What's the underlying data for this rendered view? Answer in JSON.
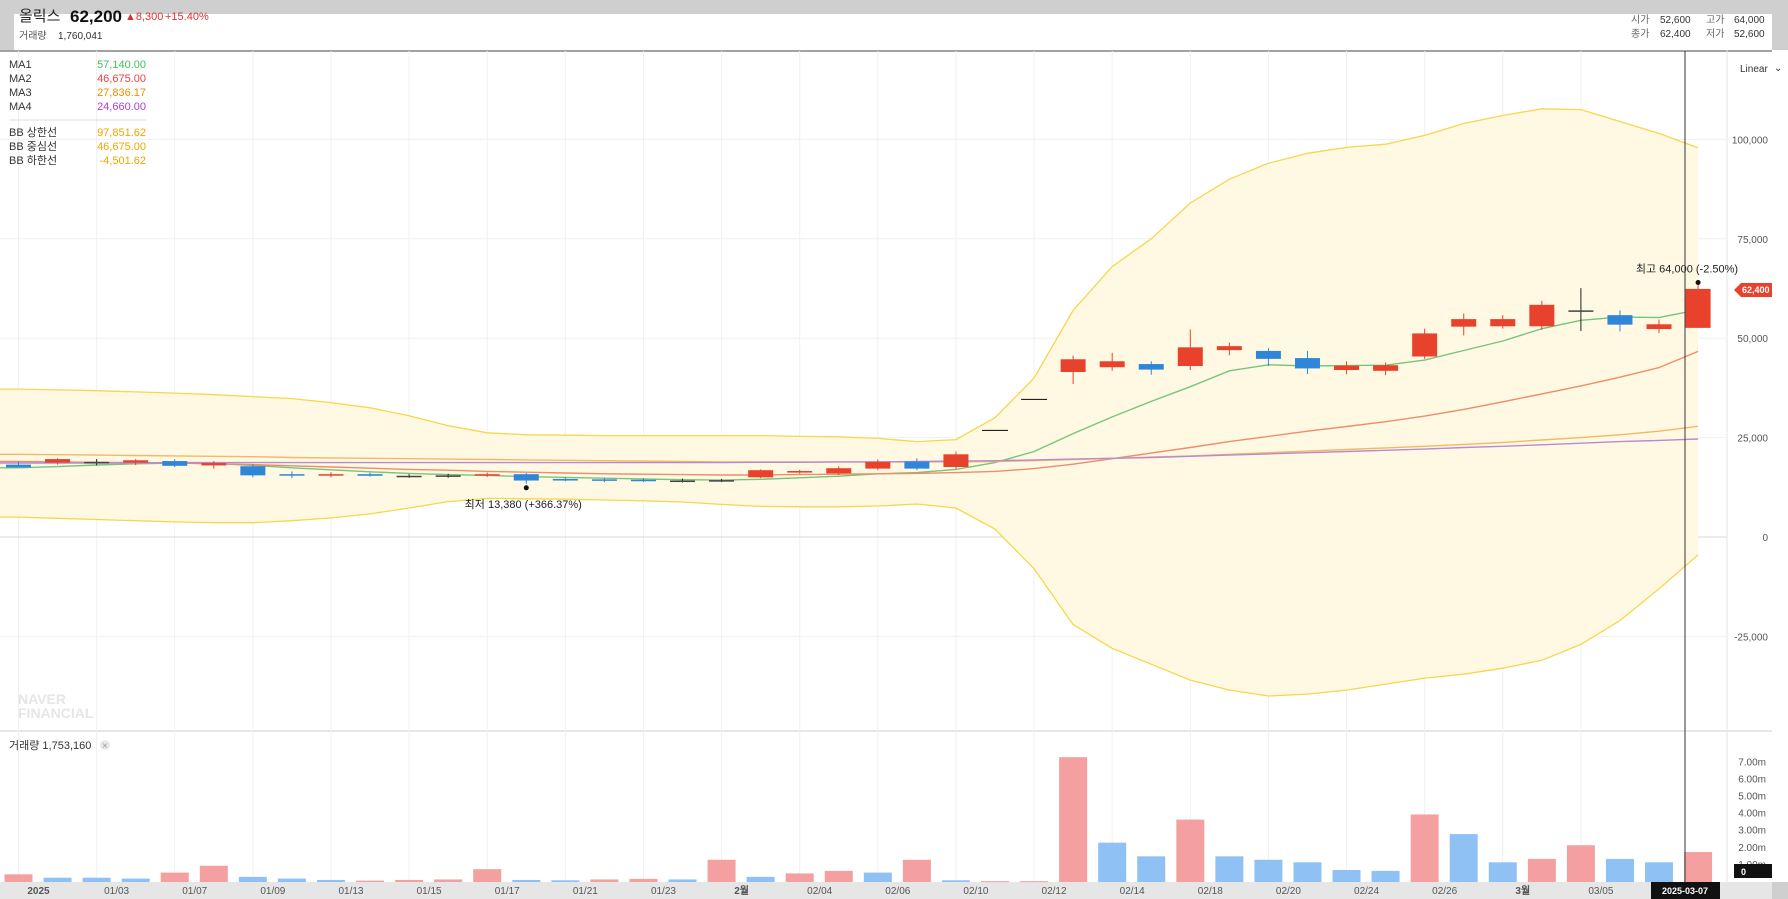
{
  "header": {
    "stock_name": "올릭스",
    "price": "62,200",
    "change": "▲8,300",
    "change_pct": "+15.40%",
    "volume_label": "거래량",
    "volume_value": "1,760,041",
    "ohlc": [
      {
        "label": "시가",
        "value": "52,600",
        "color": "#1c7ed6"
      },
      {
        "label": "고가",
        "value": "64,000",
        "color": "#e03131"
      },
      {
        "label": "종가",
        "value": "62,400",
        "color": "#e03131"
      },
      {
        "label": "저가",
        "value": "52,600",
        "color": "#1c7ed6"
      }
    ]
  },
  "legend": {
    "ma": [
      {
        "name": "MA1",
        "value": "57,140.00",
        "color": "#40c057"
      },
      {
        "name": "MA2",
        "value": "46,675.00",
        "color": "#f03e3e"
      },
      {
        "name": "MA3",
        "value": "27,836.17",
        "color": "#f08c00"
      },
      {
        "name": "MA4",
        "value": "24,660.00",
        "color": "#ae3ec9"
      }
    ],
    "bb": [
      {
        "name": "BB 상한선",
        "value": "97,851.62",
        "color": "#fab005"
      },
      {
        "name": "BB 중심선",
        "value": "46,675.00",
        "color": "#fab005"
      },
      {
        "name": "BB 하한선",
        "value": "-4,501.62",
        "color": "#fab005"
      }
    ]
  },
  "scale_mode": "Linear",
  "watermark": [
    "NAVER",
    "FINANCIAL"
  ],
  "price_badge": "62,400",
  "volume_panel": {
    "title": "거래량 1,753,160",
    "badge": "0"
  },
  "cursor_date": "2025-03-07",
  "annotations": {
    "low": "최저 13,380 (+366.37%)",
    "high": "최고 64,000 (-2.50%)"
  },
  "colors": {
    "up": "#e8412c",
    "down": "#2f86d8",
    "vol_up": "#f4a0a0",
    "vol_down": "#8fc1f5",
    "band_fill": "#fff9e3",
    "band_line": "#f7d64b"
  },
  "chart_data": [
    {
      "type": "candlestick",
      "y_ticks": [
        -25000,
        0,
        25000,
        50000,
        75000,
        100000
      ],
      "y_tick_labels": [
        "-25,000",
        "0",
        "25,000",
        "50,000",
        "75,000",
        "100,000"
      ],
      "x_tick_labels": [
        "2025",
        "01/03",
        "01/07",
        "01/09",
        "01/13",
        "01/15",
        "01/17",
        "01/21",
        "01/23",
        "2월",
        "02/04",
        "02/06",
        "02/10",
        "02/12",
        "02/14",
        "02/18",
        "02/20",
        "02/24",
        "02/26",
        "3월",
        "03/05"
      ],
      "ohlc": [
        [
          18200,
          19000,
          17500,
          17500
        ],
        [
          18700,
          19800,
          18200,
          19600
        ],
        [
          18900,
          19600,
          18000,
          18800
        ],
        [
          18700,
          19600,
          18100,
          19300
        ],
        [
          19100,
          19600,
          17600,
          17900
        ],
        [
          18000,
          19100,
          17200,
          18600
        ],
        [
          17800,
          18300,
          15000,
          15500
        ],
        [
          15800,
          16500,
          14800,
          15500
        ],
        [
          15500,
          16300,
          15000,
          15800
        ],
        [
          15800,
          16200,
          15200,
          15400
        ],
        [
          15300,
          15800,
          14900,
          15400
        ],
        [
          15400,
          15900,
          14900,
          15500
        ],
        [
          15500,
          16200,
          15100,
          15800
        ],
        [
          15800,
          16100,
          13380,
          14200
        ],
        [
          14600,
          15100,
          14000,
          14200
        ],
        [
          14500,
          14900,
          13800,
          14200
        ],
        [
          14400,
          14800,
          13800,
          14100
        ],
        [
          14200,
          14700,
          13700,
          14100
        ],
        [
          14100,
          14600,
          13800,
          14300
        ],
        [
          15000,
          17000,
          14800,
          16800
        ],
        [
          16200,
          16900,
          15900,
          16600
        ],
        [
          16000,
          17800,
          15600,
          17300
        ],
        [
          17200,
          19500,
          16800,
          18900
        ],
        [
          19000,
          19800,
          16800,
          17200
        ],
        [
          17600,
          21500,
          17100,
          20800
        ],
        [
          26800,
          26800,
          26800,
          26800
        ],
        [
          34600,
          34600,
          34600,
          34600
        ],
        [
          41500,
          45600,
          38500,
          44700
        ],
        [
          42700,
          46300,
          41800,
          44200
        ],
        [
          43500,
          44200,
          40800,
          42100
        ],
        [
          43000,
          52200,
          42000,
          47700
        ],
        [
          47000,
          48900,
          45700,
          48000
        ],
        [
          46800,
          47500,
          43000,
          44800
        ],
        [
          45000,
          46800,
          41000,
          42400
        ],
        [
          42000,
          44200,
          40900,
          43100
        ],
        [
          41800,
          43900,
          40700,
          43200
        ],
        [
          45400,
          52400,
          44800,
          51200
        ],
        [
          52900,
          56200,
          50700,
          54800
        ],
        [
          53000,
          55800,
          52400,
          54800
        ],
        [
          53000,
          59400,
          52100,
          58400
        ],
        [
          57000,
          62600,
          51800,
          56800
        ],
        [
          55800,
          57000,
          51700,
          53400
        ],
        [
          52300,
          54700,
          51300,
          53500
        ],
        [
          52600,
          64000,
          52600,
          62400
        ]
      ],
      "ma_series": [
        {
          "name": "MA1",
          "values": [
            17400,
            17700,
            18100,
            18400,
            18600,
            18500,
            18000,
            17400,
            16900,
            16400,
            16000,
            15700,
            15500,
            15200,
            15000,
            14800,
            14600,
            14400,
            14300,
            14500,
            14900,
            15300,
            15900,
            16200,
            17000,
            18700,
            21500,
            26000,
            30200,
            34100,
            37800,
            41800,
            43300,
            43000,
            43100,
            43200,
            44500,
            46900,
            49300,
            52400,
            54500,
            55300,
            55200,
            57140
          ]
        },
        {
          "name": "MA2",
          "values": [
            19000,
            18900,
            18800,
            18700,
            18600,
            18400,
            18200,
            17900,
            17600,
            17300,
            17000,
            16800,
            16500,
            16300,
            16100,
            15900,
            15800,
            15700,
            15600,
            15600,
            15700,
            15800,
            15900,
            16000,
            16200,
            16500,
            17200,
            18300,
            19700,
            21100,
            22500,
            24000,
            25300,
            26600,
            27800,
            29000,
            30400,
            32100,
            34000,
            36000,
            38000,
            40200,
            42600,
            46675
          ]
        },
        {
          "name": "MA3",
          "values": [
            20800,
            20700,
            20600,
            20500,
            20400,
            20300,
            20200,
            20000,
            19900,
            19800,
            19700,
            19600,
            19500,
            19400,
            19300,
            19200,
            19100,
            19000,
            18900,
            18900,
            18900,
            18900,
            18900,
            18900,
            18900,
            19000,
            19200,
            19500,
            19800,
            20100,
            20400,
            20800,
            21200,
            21600,
            22000,
            22400,
            22800,
            23300,
            23800,
            24400,
            25000,
            25700,
            26600,
            27836
          ]
        },
        {
          "name": "MA4",
          "values": [
            18600,
            18600,
            18600,
            18600,
            18700,
            18700,
            18700,
            18700,
            18700,
            18700,
            18700,
            18700,
            18700,
            18700,
            18700,
            18700,
            18700,
            18700,
            18700,
            18800,
            18800,
            18900,
            18900,
            19000,
            19100,
            19200,
            19400,
            19600,
            19800,
            20000,
            20300,
            20600,
            20900,
            21200,
            21500,
            21800,
            22100,
            22500,
            22800,
            23200,
            23600,
            24000,
            24300,
            24660
          ]
        }
      ],
      "bollinger": {
        "upper": [
          37200,
          37000,
          36800,
          36500,
          36200,
          35800,
          35300,
          34800,
          33800,
          32500,
          30500,
          28000,
          26200,
          25700,
          25600,
          25500,
          25500,
          25500,
          25500,
          25500,
          25300,
          25200,
          24800,
          24000,
          24500,
          30000,
          40000,
          57000,
          68000,
          75000,
          84000,
          90000,
          94000,
          96500,
          98000,
          98800,
          101000,
          104000,
          106000,
          107700,
          107500,
          104500,
          101500,
          97852
        ],
        "lower": [
          5000,
          4700,
          4400,
          4100,
          3800,
          3600,
          3600,
          4100,
          4800,
          5800,
          7300,
          8900,
          9700,
          9600,
          9500,
          9300,
          9100,
          8800,
          8200,
          7700,
          7600,
          7600,
          7800,
          8300,
          7300,
          2000,
          -8000,
          -22000,
          -28000,
          -32000,
          -36000,
          -38500,
          -40000,
          -39500,
          -38500,
          -37000,
          -35500,
          -34500,
          -33000,
          -31000,
          -27000,
          -21000,
          -13000,
          -4502
        ]
      },
      "low_point": {
        "index": 13,
        "value": 13380
      },
      "high_point": {
        "index": 43,
        "value": 64000
      }
    },
    {
      "type": "bar",
      "y_tick_labels": [
        "1.00m",
        "2.00m",
        "3.00m",
        "4.00m",
        "5.00m",
        "6.00m",
        "7.00m"
      ],
      "values": [
        0.45,
        0.25,
        0.25,
        0.2,
        0.55,
        0.95,
        0.3,
        0.2,
        0.12,
        0.08,
        0.12,
        0.15,
        0.75,
        0.12,
        0.1,
        0.15,
        0.18,
        0.15,
        1.3,
        0.3,
        0.5,
        0.65,
        0.55,
        1.3,
        0.1,
        0.05,
        0.05,
        7.3,
        2.3,
        1.5,
        3.65,
        1.5,
        1.3,
        1.15,
        0.7,
        0.65,
        3.95,
        2.8,
        1.15,
        1.35,
        2.15,
        1.35,
        1.15,
        1.75
      ],
      "up": [
        true,
        false,
        false,
        false,
        true,
        true,
        false,
        false,
        false,
        true,
        true,
        true,
        true,
        false,
        false,
        true,
        true,
        false,
        true,
        false,
        true,
        true,
        false,
        true,
        false,
        true,
        true,
        true,
        false,
        false,
        true,
        false,
        false,
        false,
        false,
        false,
        true,
        false,
        false,
        true,
        true,
        false,
        false,
        true
      ],
      "unit": "m"
    }
  ]
}
